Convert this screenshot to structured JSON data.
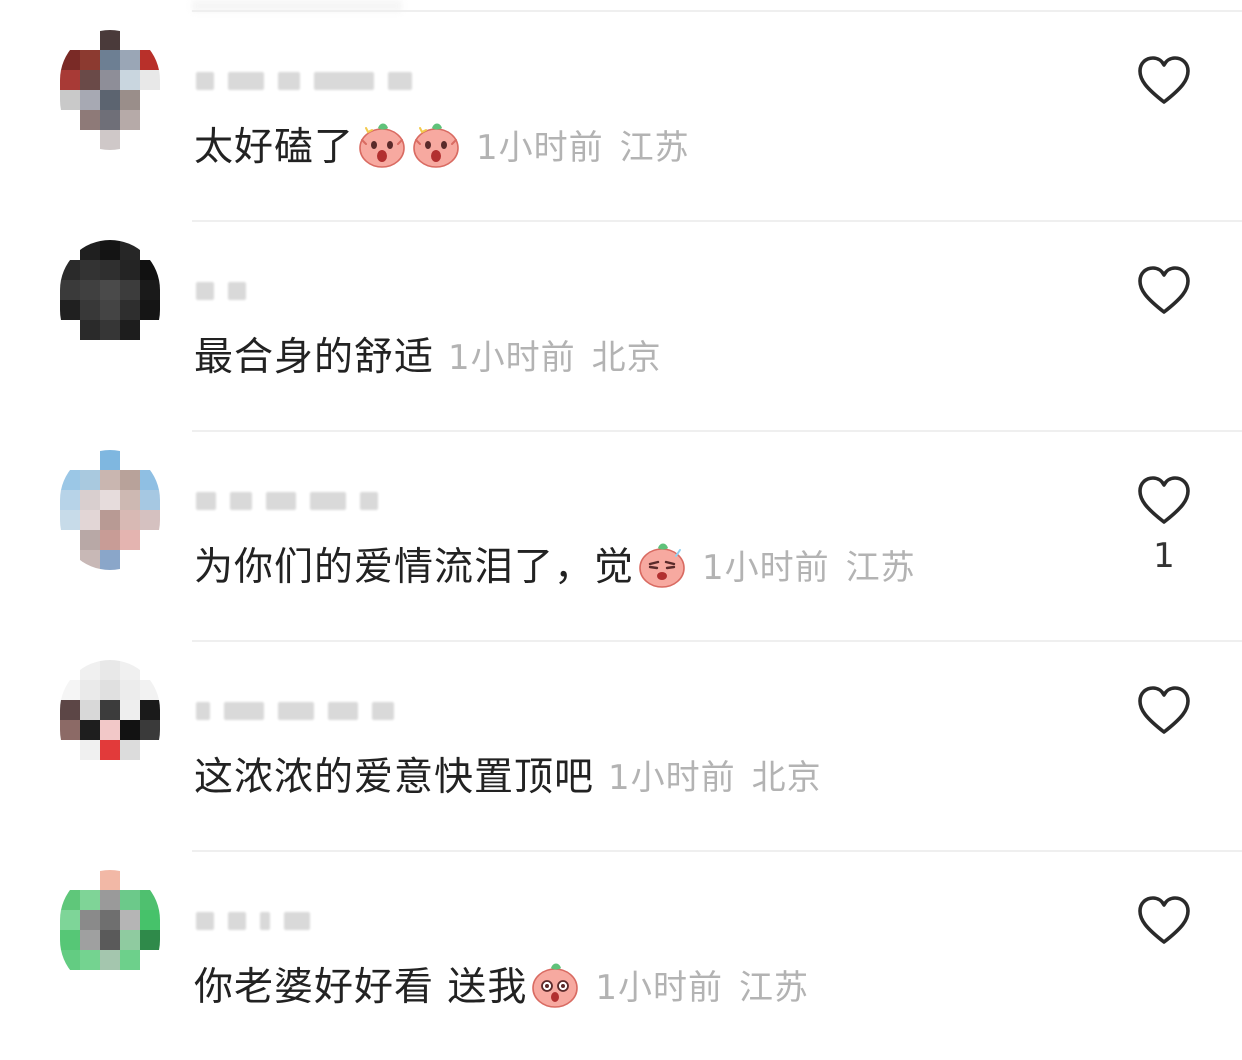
{
  "comments": [
    {
      "text": "太好磕了",
      "emojis": [
        "peach-shocked-emoji",
        "peach-shocked-emoji"
      ],
      "time": "1小时前",
      "location": "江苏",
      "likes": "",
      "avatar_colors": [
        "#ffffff",
        "#ffffff",
        "#4a3a3a",
        "#ffffff",
        "#ffffff",
        "#7a2a26",
        "#8c3a30",
        "#6d7f93",
        "#9aa6b6",
        "#b8302a",
        "#a83a36",
        "#6a4a48",
        "#8e8e98",
        "#c9d6df",
        "#e8e8e8",
        "#c9c9c9",
        "#a7a9b3",
        "#5c6470",
        "#9a8e8a",
        "#ffffff",
        "#ffffff",
        "#8e7a78",
        "#6f6f78",
        "#b6aaa8",
        "#ffffff",
        "#ffffff",
        "#ffffff",
        "#cfc8c8",
        "#ffffff",
        "#ffffff"
      ],
      "name_bar_widths": [
        18,
        36,
        22,
        60,
        24
      ]
    },
    {
      "text": "最合身的舒适",
      "emojis": [],
      "time": "1小时前",
      "location": "北京",
      "likes": "",
      "avatar_colors": [
        "#ffffff",
        "#1f1f1f",
        "#141414",
        "#262626",
        "#ffffff",
        "#2a2a2a",
        "#333333",
        "#2f2f2f",
        "#242424",
        "#111111",
        "#3a3a3a",
        "#404040",
        "#4a4a4a",
        "#3c3c3c",
        "#1a1a1a",
        "#202020",
        "#383838",
        "#444444",
        "#2e2e2e",
        "#151515",
        "#ffffff",
        "#2a2a2a",
        "#363636",
        "#1d1d1d",
        "#ffffff",
        "#ffffff",
        "#ffffff",
        "#ffffff",
        "#ffffff",
        "#ffffff"
      ],
      "name_bar_widths": [
        18,
        18
      ]
    },
    {
      "text": "为你们的爱情流泪了，觉",
      "emojis": [
        "peach-crying-emoji"
      ],
      "time": "1小时前",
      "location": "江苏",
      "likes": "1",
      "avatar_colors": [
        "#ffffff",
        "#ffffff",
        "#7fb7e0",
        "#ffffff",
        "#ffffff",
        "#9bc7e6",
        "#a9c9df",
        "#c9b6b0",
        "#b8a29a",
        "#8fbfe3",
        "#b7d3e8",
        "#d9cfcf",
        "#e6dcdc",
        "#cdb8b2",
        "#a6c8e2",
        "#c7dbe9",
        "#e2d6d6",
        "#b89a94",
        "#d8b9b4",
        "#d5c1c0",
        "#ffffff",
        "#b8a8a6",
        "#c89c96",
        "#e4b4b0",
        "#ffffff",
        "#ffffff",
        "#c8b8b6",
        "#8aa6c9",
        "#ffffff",
        "#ffffff"
      ],
      "name_bar_widths": [
        20,
        22,
        30,
        36,
        18
      ]
    },
    {
      "text": "这浓浓的爱意快置顶吧",
      "emojis": [],
      "time": "1小时前",
      "location": "北京",
      "likes": "",
      "avatar_colors": [
        "#ffffff",
        "#f0f0f0",
        "#e8e8e8",
        "#f0f0f0",
        "#ffffff",
        "#f5f5f5",
        "#eaeaea",
        "#e0e0e0",
        "#ececec",
        "#f2f2f2",
        "#5c4646",
        "#d8d8d8",
        "#3c3c3c",
        "#eeeeee",
        "#1a1a1a",
        "#8c6a66",
        "#1e1e1e",
        "#f2c8c8",
        "#121212",
        "#3a3a3a",
        "#ffffff",
        "#f0f0f0",
        "#e23a3a",
        "#dcdcdc",
        "#ffffff",
        "#ffffff",
        "#ffffff",
        "#ffffff",
        "#ffffff",
        "#ffffff"
      ],
      "name_bar_widths": [
        14,
        40,
        36,
        30,
        22
      ]
    },
    {
      "text": "你老婆好好看 送我",
      "emojis": [
        "peach-surprised-emoji"
      ],
      "time": "1小时前",
      "location": "江苏",
      "likes": "",
      "avatar_colors": [
        "#ffffff",
        "#ffffff",
        "#f2b8a6",
        "#ffffff",
        "#ffffff",
        "#5fc77a",
        "#7fd497",
        "#9a9a9a",
        "#6cc98a",
        "#4fc06f",
        "#7ed598",
        "#8a8a8a",
        "#6f6f6f",
        "#b5b5b5",
        "#46c26a",
        "#56c776",
        "#9fa0a0",
        "#5a5a5a",
        "#8fcba0",
        "#2f8a4a",
        "#63cc82",
        "#74d390",
        "#a4c6ae",
        "#6dd08b",
        "#ffffff",
        "#ffffff",
        "#ffffff",
        "#ffffff",
        "#ffffff",
        "#ffffff"
      ],
      "name_bar_widths": [
        18,
        18,
        10,
        26
      ]
    }
  ],
  "icons": {
    "like": "heart-outline-icon"
  },
  "colors": {
    "comment_text": "#222222",
    "meta_text": "#b3b3b3",
    "divider": "#efefef",
    "heart_stroke": "#2a2a2a"
  }
}
